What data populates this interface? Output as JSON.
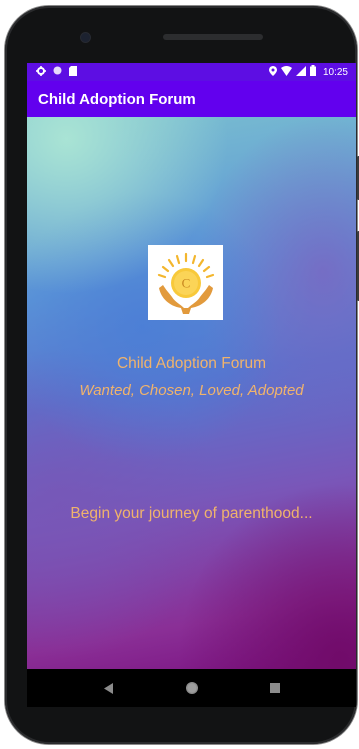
{
  "status_bar": {
    "time": "10:25",
    "left_icons": [
      "settings-icon",
      "circle-icon",
      "sd-card-icon"
    ],
    "right_icons": [
      "location-icon",
      "wifi-icon",
      "cellular-signal-icon",
      "battery-icon"
    ]
  },
  "app_bar": {
    "title": "Child Adoption Forum"
  },
  "main": {
    "logo_icon": "sun-hands-logo",
    "logo_letter": "C",
    "title": "Child Adoption Forum",
    "tagline": "Wanted, Chosen, Loved, Adopted",
    "journey_text": "Begin your journey of parenthood..."
  },
  "nav_bar": {
    "buttons": [
      "back-icon",
      "home-icon",
      "recents-icon"
    ]
  },
  "colors": {
    "status_bar": "#5d0ee3",
    "app_bar": "#6200ee",
    "accent_text": "#f0b36c",
    "logo_sun": "#f6c531",
    "logo_hands": "#e09a3a"
  }
}
